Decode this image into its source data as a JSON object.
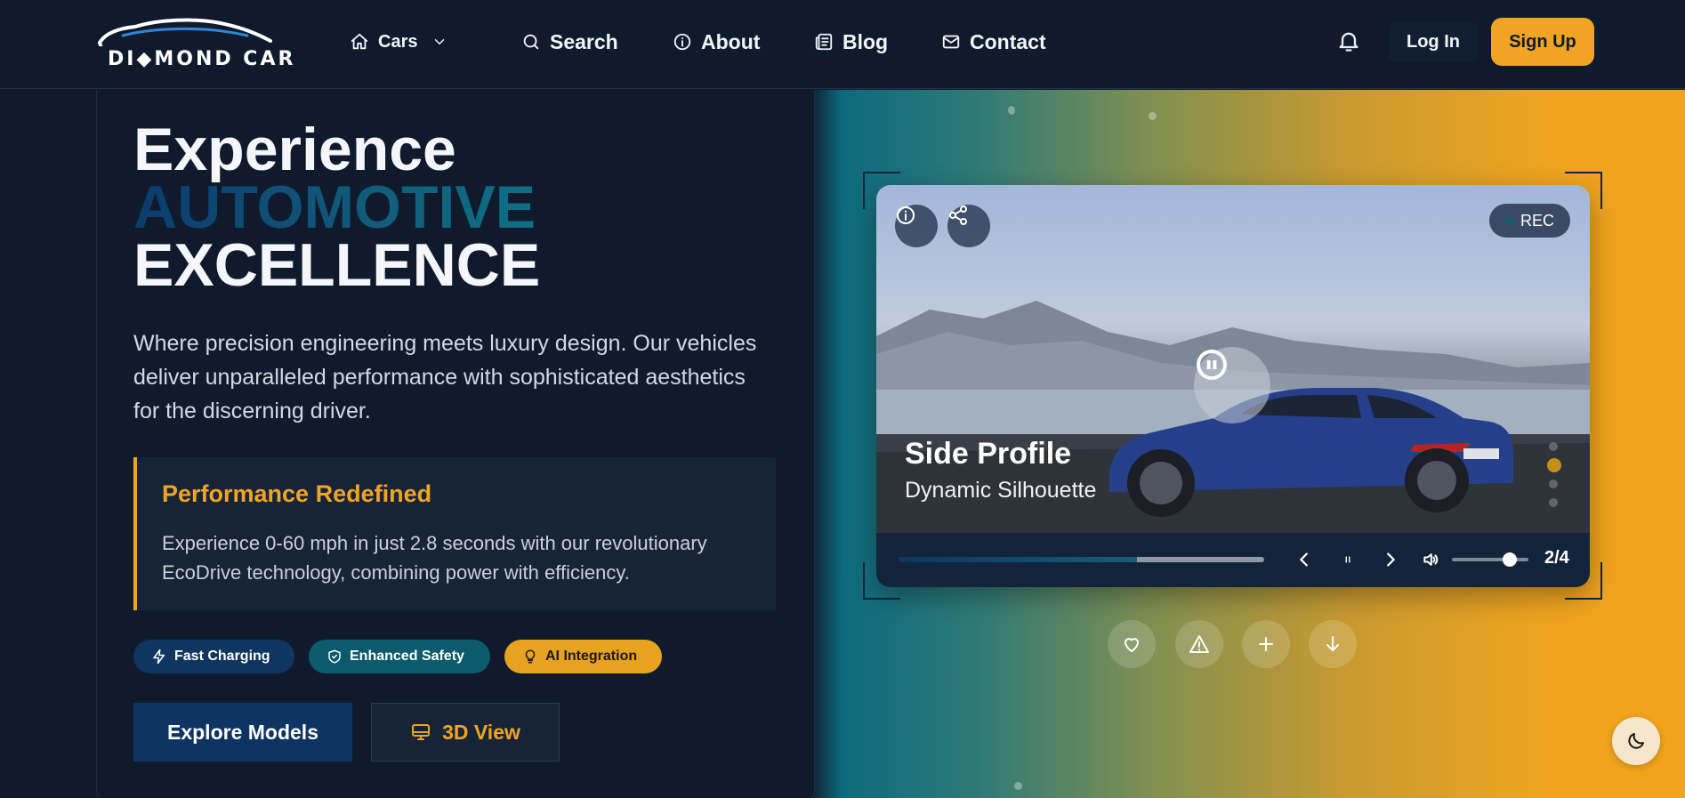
{
  "brand": {
    "name": "DIAMOND CAR",
    "logo_lettering": "DI◆MOND CAR"
  },
  "nav": {
    "items": [
      {
        "label": "Cars",
        "icon": "home-icon",
        "has_dropdown": true
      },
      {
        "label": "Search",
        "icon": "search-icon"
      },
      {
        "label": "About",
        "icon": "info-icon"
      },
      {
        "label": "Blog",
        "icon": "newspaper-icon"
      },
      {
        "label": "Contact",
        "icon": "mail-icon"
      }
    ],
    "login_label": "Log In",
    "signup_label": "Sign Up"
  },
  "hero": {
    "title_line1": "Experience",
    "title_line2": "AUTOMOTIVE",
    "title_line3": "EXCELLENCE",
    "lead": "Where precision engineering meets luxury design. Our vehicles deliver unparalleled performance with sophisticated aesthetics for the discerning driver.",
    "feature_card": {
      "title": "Performance Redefined",
      "body": "Experience 0-60 mph in just 2.8 seconds with our revolutionary EcoDrive technology, combining power with efficiency."
    },
    "chips": [
      {
        "label": "Fast Charging",
        "icon": "zap-icon"
      },
      {
        "label": "Enhanced Safety",
        "icon": "shield-check-icon"
      },
      {
        "label": "AI Integration",
        "icon": "lightbulb-icon"
      }
    ],
    "primary_button": "Explore Models",
    "secondary_button": "3D View"
  },
  "player": {
    "rec_label": "REC",
    "slide_title": "Side Profile",
    "slide_subtitle": "Dynamic Silhouette",
    "progress": 0.65,
    "volume": 0.75,
    "counter": "2/4",
    "active_slide_index": 1
  },
  "colors": {
    "accent": "#f0a423",
    "navy": "#0f1b2d",
    "primary_button": "#0d3462",
    "teal": "#0c5a6c"
  }
}
